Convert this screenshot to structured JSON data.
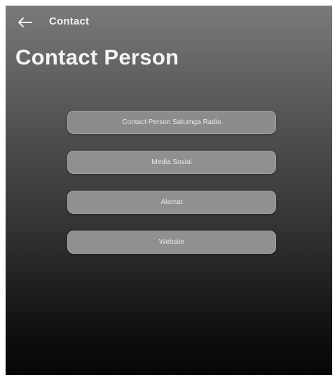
{
  "topbar": {
    "back_icon": "arrow-left-icon",
    "title": "Contact"
  },
  "page": {
    "heading": "Contact Person"
  },
  "menu": {
    "items": [
      {
        "label": "Contact Person Saturnga Radio"
      },
      {
        "label": "Media Sosial"
      },
      {
        "label": "Alamat"
      },
      {
        "label": "Website"
      }
    ]
  },
  "colors": {
    "gradient_top": "#7a7a7a",
    "gradient_bottom": "#050505",
    "button_fill": "#909090",
    "text": "#f4f4f4"
  }
}
